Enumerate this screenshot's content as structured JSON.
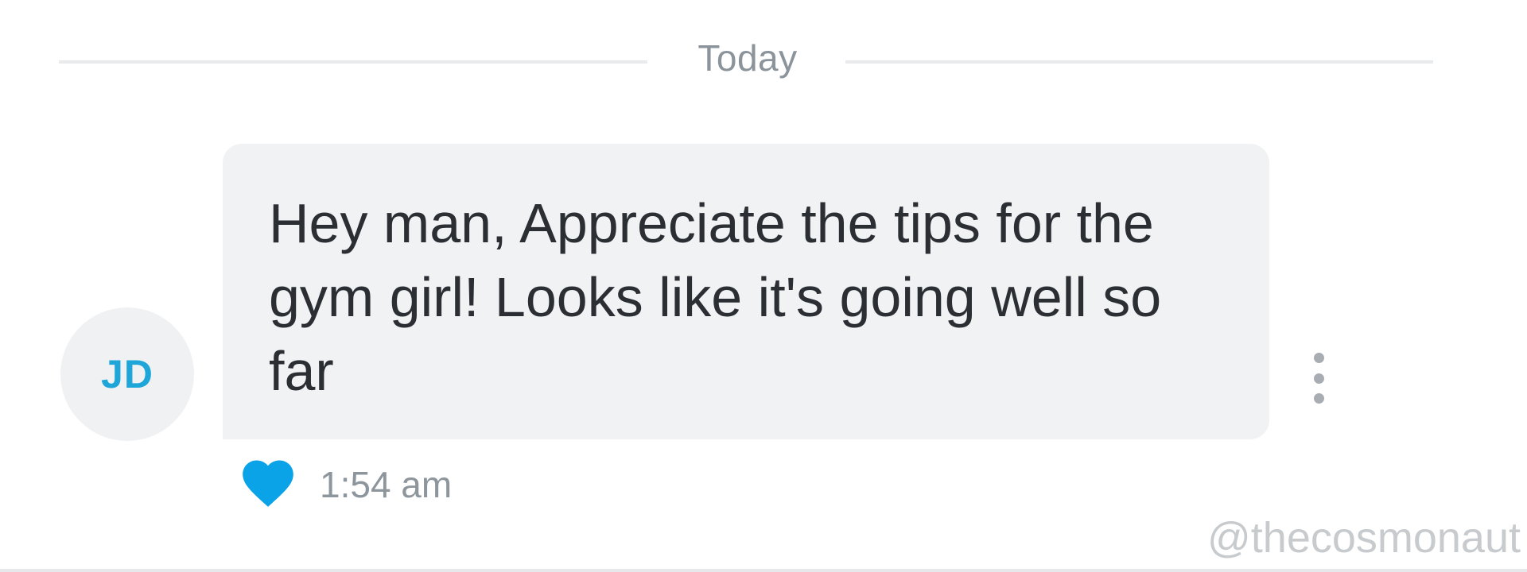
{
  "date_divider": {
    "label": "Today"
  },
  "message": {
    "sender_initials": "JD",
    "text": "Hey man, Appreciate the tips for the gym girl! Looks like it's going well so far",
    "time": "1:54 am",
    "reaction_icon": "heart-icon",
    "options_icon": "more-vertical-icon"
  },
  "watermark": "@thecosmonaut",
  "colors": {
    "accent": "#1ea6d9",
    "heart": "#0aa3e8",
    "bubble_bg": "#f0f2f4",
    "muted_text": "#8b939b"
  }
}
